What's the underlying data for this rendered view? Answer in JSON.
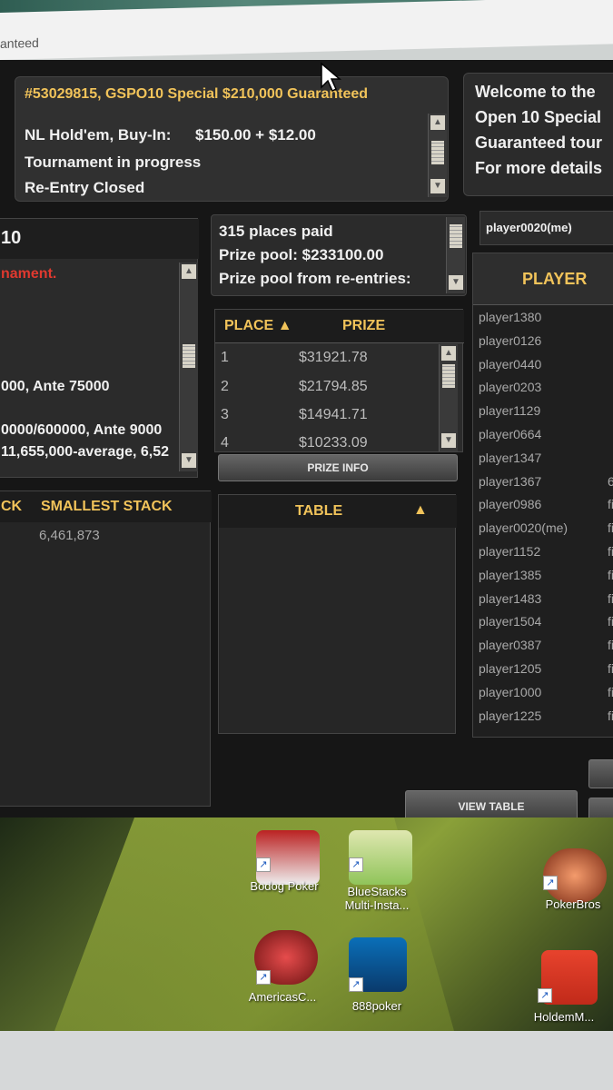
{
  "window": {
    "title_fragment": "anteed"
  },
  "tournament": {
    "title": "#53029815, GSPO10 Special $210,000 Guaranteed",
    "game": "NL Hold'em, Buy-In:",
    "buyin": "$150.00 + $12.00",
    "status": "Tournament in progress",
    "reentry": "Re-Entry Closed"
  },
  "welcome": {
    "lines": [
      "Welcome to the",
      "Open 10 Special",
      "Guaranteed tour",
      "For more details"
    ]
  },
  "left_info": {
    "header": "10",
    "red_text": "nament.",
    "level": "000, Ante 75000",
    "next_level": "0000/600000, Ante 9000",
    "stacks_summary": "11,655,000-average, 6,52"
  },
  "places": {
    "paid": "315 places paid",
    "pool": "Prize pool: $233100.00",
    "reentries": "Prize pool from re-entries:"
  },
  "prize_table": {
    "col_place": "PLACE",
    "col_prize": "PRIZE",
    "rows": [
      {
        "place": "1",
        "prize": "$31921.78"
      },
      {
        "place": "2",
        "prize": "$21794.85"
      },
      {
        "place": "3",
        "prize": "$14941.71"
      },
      {
        "place": "4",
        "prize": "$10233.09"
      }
    ],
    "button": "PRIZE INFO"
  },
  "stacks": {
    "col_largest": "CK",
    "col_smallest": "SMALLEST STACK",
    "smallest_value": "6,461,873"
  },
  "table_panel": {
    "header": "TABLE"
  },
  "view_table_button": "VIEW TABLE",
  "me": "player0020(me)",
  "players": {
    "header": "PLAYER",
    "list": [
      {
        "name": "player1380",
        "stack": ""
      },
      {
        "name": "player0126",
        "stack": ""
      },
      {
        "name": "player0440",
        "stack": ""
      },
      {
        "name": "player0203",
        "stack": ""
      },
      {
        "name": "player1129",
        "stack": ""
      },
      {
        "name": "player0664",
        "stack": ""
      },
      {
        "name": "player1347",
        "stack": ""
      },
      {
        "name": "player1367",
        "stack": "6"
      },
      {
        "name": "player0986",
        "stack": "fi"
      },
      {
        "name": "player0020(me)",
        "stack": "fi"
      },
      {
        "name": "player1152",
        "stack": "fi"
      },
      {
        "name": "player1385",
        "stack": "fi"
      },
      {
        "name": "player1483",
        "stack": "fi"
      },
      {
        "name": "player1504",
        "stack": "fi"
      },
      {
        "name": "player0387",
        "stack": "fin"
      },
      {
        "name": "player1205",
        "stack": "fin"
      },
      {
        "name": "player1000",
        "stack": "fin"
      },
      {
        "name": "player1225",
        "stack": "fin"
      }
    ]
  },
  "desktop_icons": [
    {
      "label": "Bodog Poker"
    },
    {
      "label": "BlueStacks\nMulti-Insta..."
    },
    {
      "label": "PokerBros"
    },
    {
      "label": "AmericasC..."
    },
    {
      "label": "888poker"
    },
    {
      "label": "HoldemM..."
    }
  ]
}
